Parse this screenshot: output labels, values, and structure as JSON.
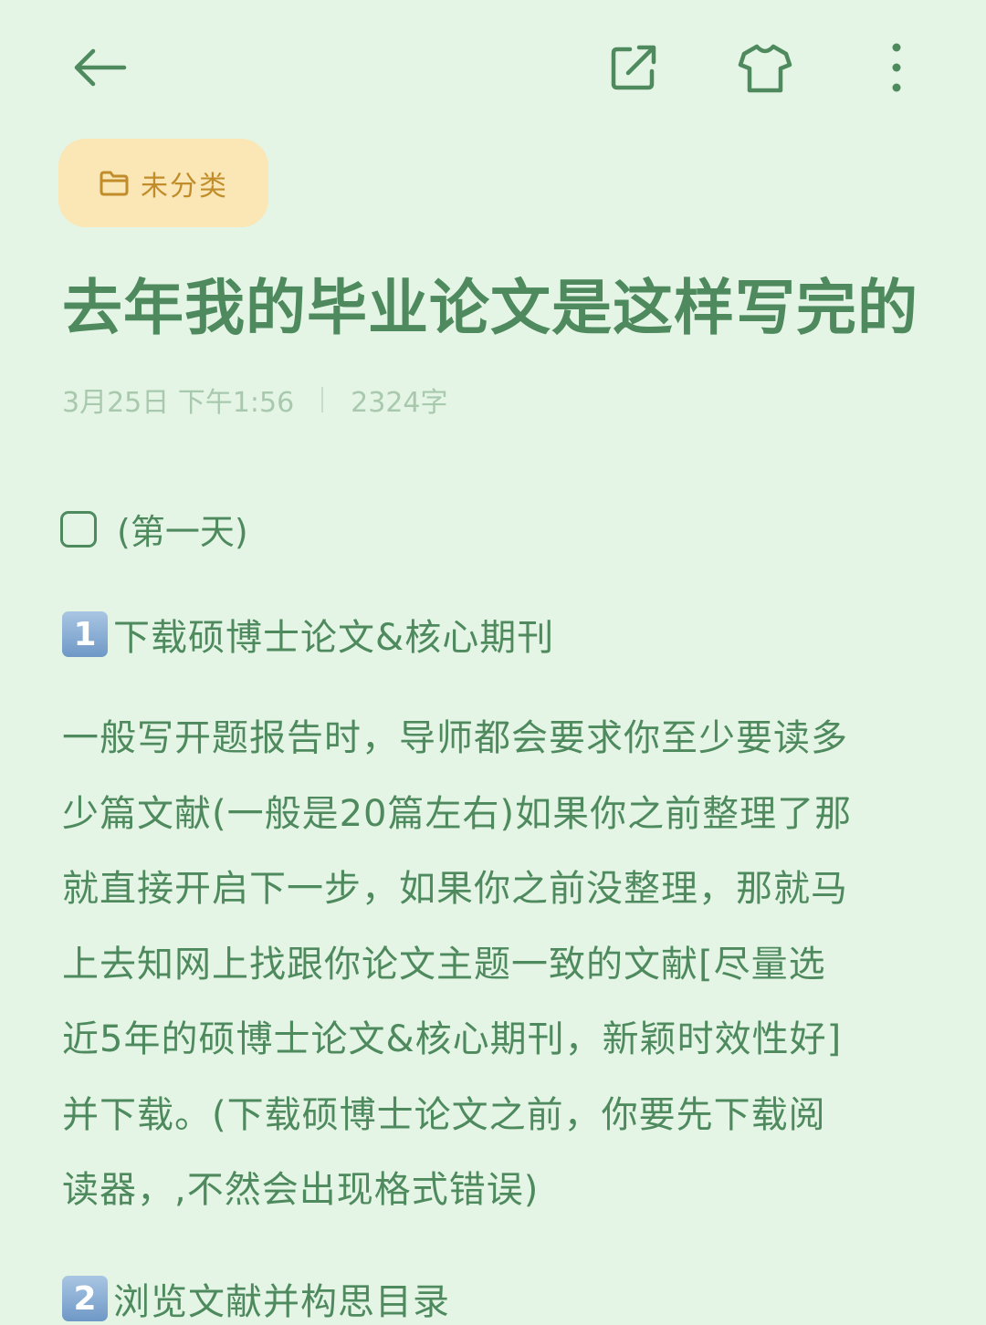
{
  "icons": {
    "back": "arrow-left-icon",
    "share": "share-external-icon",
    "theme": "tshirt-icon",
    "more": "more-vertical-icon",
    "category": "folder-icon"
  },
  "colors": {
    "background": "#e4f5e5",
    "text": "#4e8a5e",
    "chip_background": "#fbe6b6",
    "chip_text": "#c08d2a",
    "meta_text": "#a9c9af"
  },
  "category": {
    "label": "未分类"
  },
  "note": {
    "title": "去年我的毕业论文是这样写完的",
    "date": "3月25日 下午1:56",
    "word_count": "2324字"
  },
  "checklist": {
    "item1": "(第一天)",
    "item1_checked": false
  },
  "sections": [
    {
      "number": "1",
      "title": "下载硕博士论文&核心期刊"
    },
    {
      "number": "2",
      "title": "浏览文献并构思目录"
    }
  ],
  "paragraph1_lines": [
    "一般写开题报告时，导师都会要求你至少要读多",
    "少篇文献(一般是20篇左右)如果你之前整理了那",
    "就直接开启下一步，如果你之前没整理，那就马",
    "上去知网上找跟你论文主题一致的文献[尽量选",
    "近5年的硕博士论文&核心期刊，新颖时效性好]",
    "并下载。(下载硕博士论文之前，你要先下载阅",
    "读器，,不然会出现格式错误)"
  ]
}
